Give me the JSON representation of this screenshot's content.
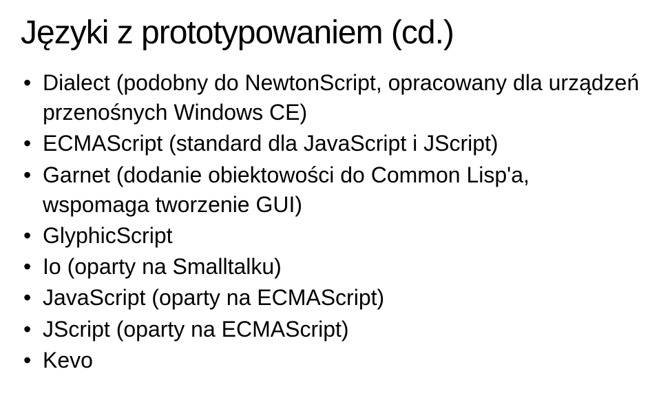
{
  "title": "Języki z prototypowaniem (cd.)",
  "bullets": [
    "Dialect (podobny do NewtonScript, opracowany dla urządzeń przenośnych Windows CE)",
    "ECMAScript (standard dla JavaScript i JScript)",
    "Garnet (dodanie obiektowości do Common Lisp'a, wspomaga tworzenie GUI)",
    "GlyphicScript",
    "Io (oparty na Smalltalku)",
    "JavaScript (oparty na ECMAScript)",
    "JScript (oparty na ECMAScript)",
    "Kevo"
  ]
}
